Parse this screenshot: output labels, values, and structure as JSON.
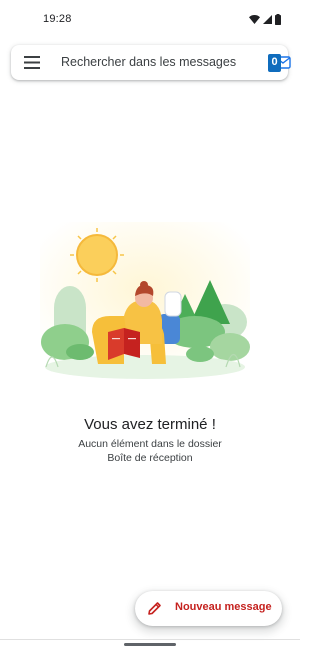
{
  "status_bar": {
    "time": "19:28",
    "icons": [
      "wifi-icon",
      "signal-icon",
      "battery-icon"
    ]
  },
  "search": {
    "placeholder": "Rechercher dans les messages",
    "account_badge": "0"
  },
  "empty_state": {
    "title": "Vous avez terminé !",
    "line1": "Aucun élément dans le dossier",
    "line2": "Boîte de réception"
  },
  "fab": {
    "label": "Nouveau message",
    "icon": "pencil-icon"
  },
  "colors": {
    "accent": "#c5221f",
    "outlook_blue": "#0f6cbd"
  }
}
